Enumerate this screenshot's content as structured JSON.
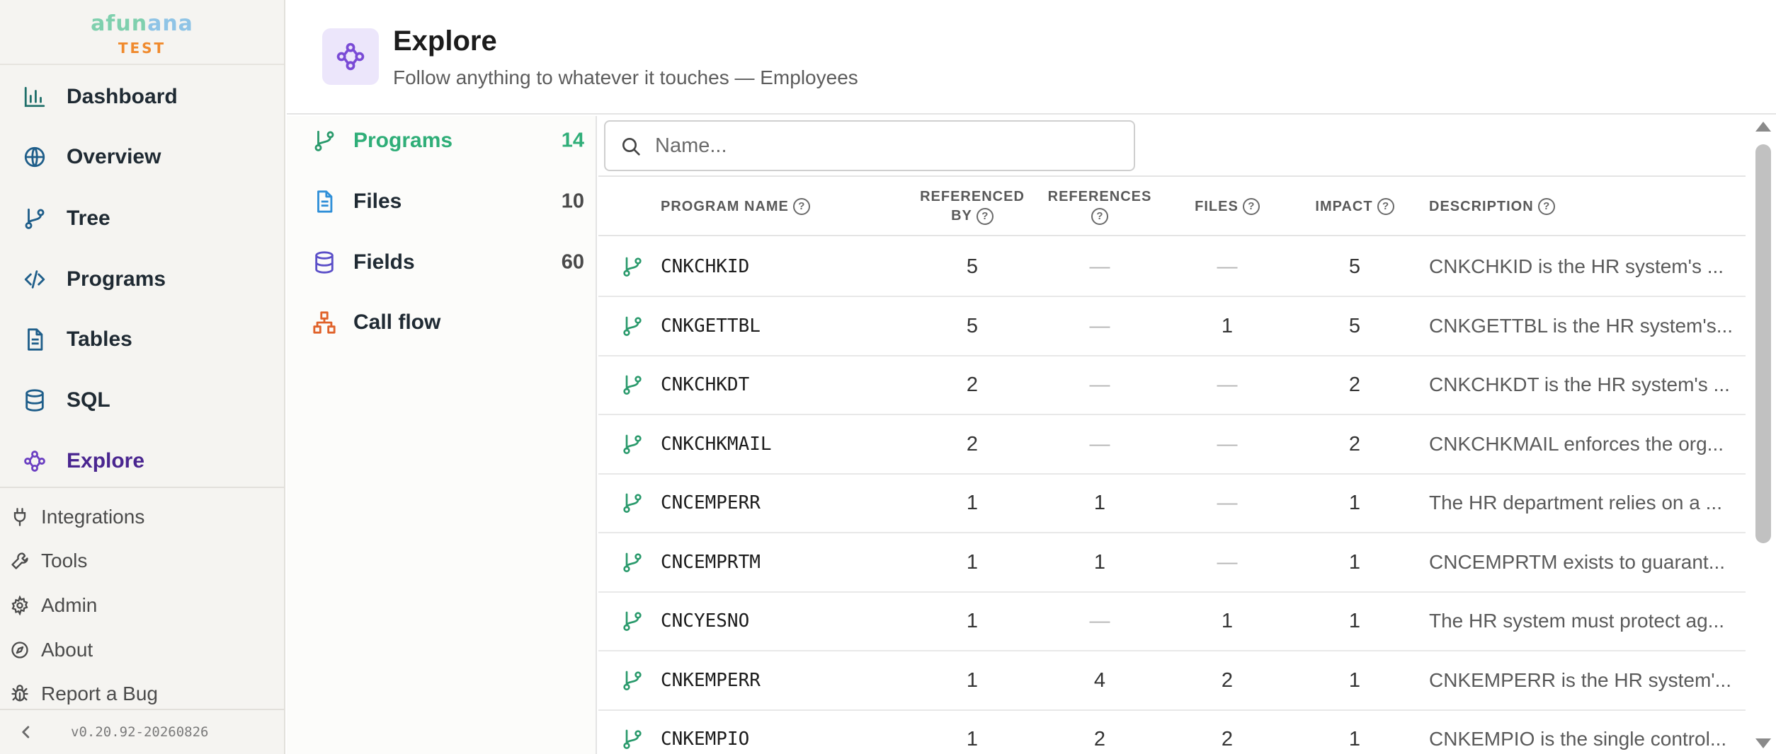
{
  "brand": {
    "name_part1": "afun",
    "name_part2": "ana",
    "env": "TEST"
  },
  "sidebar": {
    "items": [
      {
        "label": "Dashboard",
        "icon": "bar-chart-icon"
      },
      {
        "label": "Overview",
        "icon": "globe-icon"
      },
      {
        "label": "Tree",
        "icon": "git-branch-icon"
      },
      {
        "label": "Programs",
        "icon": "code-icon"
      },
      {
        "label": "Tables",
        "icon": "document-icon"
      },
      {
        "label": "SQL",
        "icon": "database-icon"
      },
      {
        "label": "Explore",
        "icon": "explore-graph-icon",
        "active": true
      }
    ],
    "secondary": [
      {
        "label": "Integrations",
        "icon": "plug-icon"
      },
      {
        "label": "Tools",
        "icon": "wrench-icon"
      },
      {
        "label": "Admin",
        "icon": "gear-icon"
      },
      {
        "label": "About",
        "icon": "compass-icon"
      },
      {
        "label": "Report a Bug",
        "icon": "bug-icon"
      }
    ],
    "version": "v0.20.92-20260826"
  },
  "header": {
    "title": "Explore",
    "subtitle": "Follow anything to whatever it touches — Employees"
  },
  "panel": {
    "items": [
      {
        "label": "Programs",
        "count": "14",
        "active": true
      },
      {
        "label": "Files",
        "count": "10"
      },
      {
        "label": "Fields",
        "count": "60"
      },
      {
        "label": "Call flow",
        "count": ""
      }
    ]
  },
  "search": {
    "placeholder": "Name...",
    "value": ""
  },
  "table": {
    "columns": {
      "name": "PROGRAM NAME",
      "referenced_by_1": "REFERENCED",
      "referenced_by_2": "BY",
      "references": "REFERENCES",
      "files": "FILES",
      "impact": "IMPACT",
      "description": "DESCRIPTION"
    },
    "help_glyph": "?",
    "rows": [
      {
        "name": "CNKCHKID",
        "referenced_by": "5",
        "references": "—",
        "files": "—",
        "impact": "5",
        "description": "CNKCHKID is the HR system's ..."
      },
      {
        "name": "CNKGETTBL",
        "referenced_by": "5",
        "references": "—",
        "files": "1",
        "impact": "5",
        "description": "CNKGETTBL is the HR system's..."
      },
      {
        "name": "CNKCHKDT",
        "referenced_by": "2",
        "references": "—",
        "files": "—",
        "impact": "2",
        "description": "CNKCHKDT is the HR system's ..."
      },
      {
        "name": "CNKCHKMAIL",
        "referenced_by": "2",
        "references": "—",
        "files": "—",
        "impact": "2",
        "description": "CNKCHKMAIL enforces the org..."
      },
      {
        "name": "CNCEMPERR",
        "referenced_by": "1",
        "references": "1",
        "files": "—",
        "impact": "1",
        "description": "The HR department relies on a ..."
      },
      {
        "name": "CNCEMPRTM",
        "referenced_by": "1",
        "references": "1",
        "files": "—",
        "impact": "1",
        "description": "CNCEMPRTM exists to guarant..."
      },
      {
        "name": "CNCYESNO",
        "referenced_by": "1",
        "references": "—",
        "files": "1",
        "impact": "1",
        "description": "The HR system must protect ag..."
      },
      {
        "name": "CNKEMPERR",
        "referenced_by": "1",
        "references": "4",
        "files": "2",
        "impact": "1",
        "description": "CNKEMPERR is the HR system'..."
      },
      {
        "name": "CNKEMPIO",
        "referenced_by": "1",
        "references": "2",
        "files": "2",
        "impact": "1",
        "description": "CNKEMPIO is the single control..."
      }
    ]
  },
  "colors": {
    "accent_green": "#2fae78",
    "accent_purple": "#4a2690",
    "brand_mint": "#7fd0ae",
    "brand_orange": "#f08a2d"
  }
}
